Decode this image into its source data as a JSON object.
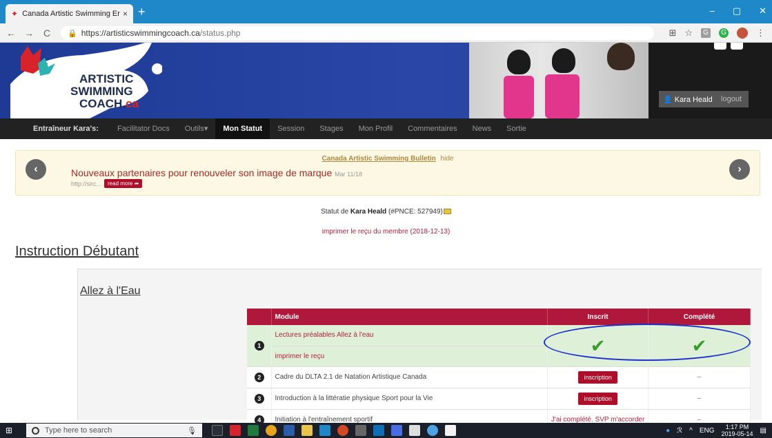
{
  "browser": {
    "tab_title": "Canada Artistic Swimming Entrai",
    "tab_close": "×",
    "new_tab": "+",
    "url_host": "https://artisticswimmingcoach.ca",
    "url_path": "/status.php"
  },
  "site": {
    "user_name": "Kara Heald",
    "logout": "logout"
  },
  "nav": {
    "brand": "Entraîneur Kara's:",
    "items": [
      "Facilitator Docs",
      "Outils▾",
      "Mon Statut",
      "Session",
      "Stages",
      "Mon Profil",
      "Commentaires",
      "News",
      "Sortie"
    ]
  },
  "bulletin": {
    "header_link": "Canada Artistic Swimming Bulletin",
    "hide": "hide",
    "title": "Nouveaux partenaires pour renouveler son image de marque",
    "date": "Mar 11/18",
    "url": "http://sirc...",
    "read_more": "read more ➦",
    "prev": "‹",
    "next": "›"
  },
  "status": {
    "prefix": "Statut de",
    "name": "Kara Heald",
    "pnce": "(#PNCE: 527949)",
    "receipt": "imprimer le reçu du membre (2018-12-13)"
  },
  "section": {
    "title": "Instruction Débutant",
    "subtitle": "Allez à l'Eau"
  },
  "table": {
    "headers": [
      "",
      "Module",
      "Inscrit",
      "Complété"
    ],
    "rows": [
      {
        "num": "1",
        "module": "Lectures préalables Allez à l'eau",
        "sub": "imprimer le reçu",
        "inscrit": "✔",
        "complete": "✔"
      },
      {
        "num": "2",
        "module": "Cadre du DLTA 2.1 de Natation Artistique Canada",
        "inscrit": "inscription",
        "complete": "–"
      },
      {
        "num": "3",
        "module": "Introduction à la littératie physique Sport pour la Vie",
        "inscrit": "inscription",
        "complete": "–"
      },
      {
        "num": "4",
        "module": "Initiation à l'entraînement sportif",
        "inscrit": "J'ai complété. SVP m'accorder",
        "complete": "–"
      }
    ]
  },
  "taskbar": {
    "search_placeholder": "Type here to search",
    "lang": "ENG",
    "time": "1:17 PM",
    "date": "2019-05-14"
  },
  "colors": {
    "accent_red": "#b0183b",
    "success_green": "#3a9c2a",
    "annotation_blue": "#1a2fd0"
  }
}
